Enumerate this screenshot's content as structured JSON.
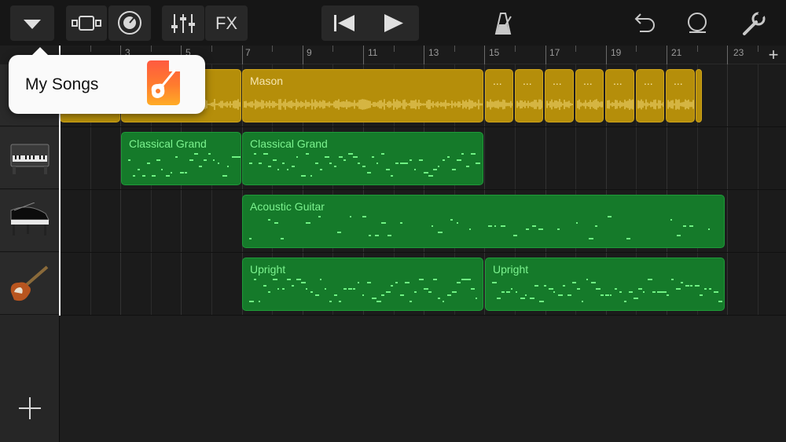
{
  "toolbar": {
    "fx_label": "FX",
    "icons": [
      "dropdown-triangle-icon",
      "tracks-view-icon",
      "smart-control-icon",
      "mixer-icon",
      "go-to-beginning-icon",
      "play-icon",
      "metronome-icon",
      "undo-icon",
      "loop-icon",
      "settings-wrench-icon"
    ]
  },
  "ruler": {
    "bar_numbers": [
      "3",
      "5",
      "7",
      "9",
      "11",
      "13",
      "15",
      "17",
      "19",
      "21",
      "23"
    ],
    "add_section_label": "+"
  },
  "popover": {
    "label": "My Songs",
    "icon": "garageband-app-icon"
  },
  "tracks": [
    {
      "instrument": "audio-recorder",
      "icon": "microphone-icon",
      "regions": [
        {
          "label": "",
          "type": "audio"
        },
        {
          "label": "",
          "type": "audio"
        },
        {
          "label": "Mason",
          "type": "audio"
        },
        {
          "label": "...",
          "type": "audio"
        },
        {
          "label": "...",
          "type": "audio"
        },
        {
          "label": "...",
          "type": "audio"
        },
        {
          "label": "...",
          "type": "audio"
        },
        {
          "label": "...",
          "type": "audio"
        },
        {
          "label": "...",
          "type": "audio"
        },
        {
          "label": "...",
          "type": "audio"
        },
        {
          "label": "",
          "type": "audio"
        }
      ]
    },
    {
      "instrument": "upright-piano",
      "icon": "upright-piano-icon",
      "regions": [
        {
          "label": "Classical Grand",
          "type": "midi"
        },
        {
          "label": "Classical Grand",
          "type": "midi"
        }
      ]
    },
    {
      "instrument": "grand-piano",
      "icon": "grand-piano-icon",
      "regions": [
        {
          "label": "Acoustic Guitar",
          "type": "midi"
        }
      ]
    },
    {
      "instrument": "bass-guitar",
      "icon": "bass-guitar-icon",
      "regions": [
        {
          "label": "Upright",
          "type": "midi"
        },
        {
          "label": "Upright",
          "type": "midi"
        }
      ]
    }
  ],
  "add_track_label": "+",
  "colors": {
    "audio_region": "#b58e0a",
    "midi_region": "#157a2a",
    "midi_label": "#7cf38f",
    "background": "#1e1e1e"
  }
}
